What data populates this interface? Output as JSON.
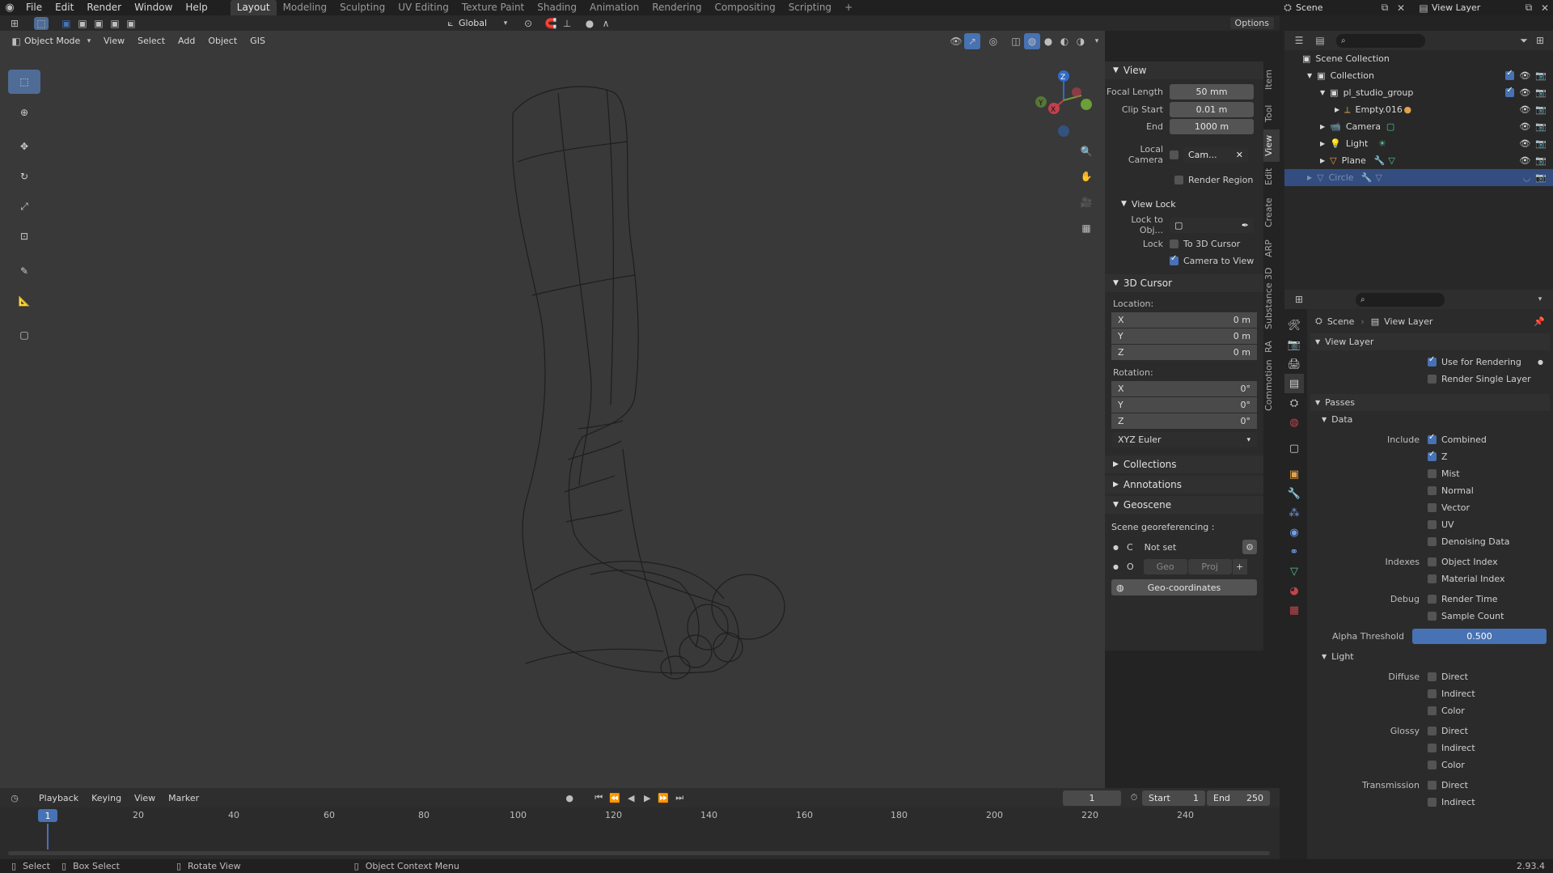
{
  "menu": [
    "File",
    "Edit",
    "Render",
    "Window",
    "Help"
  ],
  "workspaces": [
    "Layout",
    "Modeling",
    "Sculpting",
    "UV Editing",
    "Texture Paint",
    "Shading",
    "Animation",
    "Rendering",
    "Compositing",
    "Scripting"
  ],
  "active_workspace": "Layout",
  "scene_name": "Scene",
  "view_layer_name": "View Layer",
  "toolbar": {
    "orientation": "Global",
    "options": "Options"
  },
  "viewport_header": {
    "mode": "Object Mode",
    "menus": [
      "View",
      "Select",
      "Add",
      "Object",
      "GIS"
    ]
  },
  "gizmo_axes": {
    "x": "X",
    "y": "Y",
    "z": "Z"
  },
  "npanel": {
    "view_title": "View",
    "focal_length_label": "Focal Length",
    "focal_length": "50 mm",
    "clip_start_label": "Clip Start",
    "clip_start": "0.01 m",
    "end_label": "End",
    "clip_end": "1000 m",
    "local_camera_label": "Local Camera",
    "local_camera_value": "Cam...",
    "render_region_label": "Render Region",
    "view_lock_title": "View Lock",
    "lock_to_obj_label": "Lock to Obj...",
    "lock_label": "Lock",
    "to_3d_cursor_label": "To 3D Cursor",
    "camera_to_view_label": "Camera to View",
    "cursor_title": "3D Cursor",
    "location_label": "Location:",
    "loc": [
      {
        "axis": "X",
        "value": "0 m"
      },
      {
        "axis": "Y",
        "value": "0 m"
      },
      {
        "axis": "Z",
        "value": "0 m"
      }
    ],
    "rotation_label": "Rotation:",
    "rot": [
      {
        "axis": "X",
        "value": "0°"
      },
      {
        "axis": "Y",
        "value": "0°"
      },
      {
        "axis": "Z",
        "value": "0°"
      }
    ],
    "rotation_mode": "XYZ Euler",
    "collections_title": "Collections",
    "annotations_title": "Annotations",
    "geoscene_title": "Geoscene",
    "georef_label": "Scene georeferencing :",
    "c_label": "C",
    "not_set": "Not set",
    "o_label": "O",
    "geo_btn": "Geo",
    "proj_btn": "Proj",
    "geo_coords_btn": "Geo-coordinates"
  },
  "vertical_tabs": [
    "Item",
    "Tool",
    "View",
    "Edit",
    "Create",
    "ARP",
    "Substance 3D",
    "RA",
    "Commotion"
  ],
  "outliner": {
    "scene_collection": "Scene Collection",
    "items": [
      {
        "name": "Collection",
        "indent": 1
      },
      {
        "name": "pl_studio_group",
        "indent": 2
      },
      {
        "name": "Empty.016",
        "indent": 3
      },
      {
        "name": "Camera",
        "indent": 2
      },
      {
        "name": "Light",
        "indent": 2
      },
      {
        "name": "Plane",
        "indent": 2
      },
      {
        "name": "Circle",
        "indent": 1
      }
    ]
  },
  "properties": {
    "crumb_scene": "Scene",
    "crumb_view_layer": "View Layer",
    "view_layer_title": "View Layer",
    "use_for_rendering": "Use for Rendering",
    "render_single_layer": "Render Single Layer",
    "passes_title": "Passes",
    "data_title": "Data",
    "include_label": "Include",
    "include": [
      "Combined",
      "Z",
      "Mist",
      "Normal",
      "Vector",
      "UV",
      "Denoising Data"
    ],
    "indexes_label": "Indexes",
    "indexes": [
      "Object Index",
      "Material Index"
    ],
    "debug_label": "Debug",
    "debug": [
      "Render Time",
      "Sample Count"
    ],
    "alpha_label": "Alpha Threshold",
    "alpha_value": "0.500",
    "light_title": "Light",
    "diffuse_label": "Diffuse",
    "diffuse": [
      "Direct",
      "Indirect",
      "Color"
    ],
    "glossy_label": "Glossy",
    "glossy": [
      "Direct",
      "Indirect",
      "Color"
    ],
    "transmission_label": "Transmission",
    "transmission": [
      "Direct",
      "Indirect"
    ]
  },
  "timeline": {
    "menus": [
      "Playback",
      "Keying",
      "View",
      "Marker"
    ],
    "current_frame": "1",
    "start_label": "Start",
    "start": "1",
    "end_label": "End",
    "end": "250",
    "ticks": [
      "20",
      "40",
      "60",
      "80",
      "100",
      "120",
      "140",
      "160",
      "180",
      "200",
      "220",
      "240"
    ],
    "playhead": "1"
  },
  "status": {
    "select": "Select",
    "box_select": "Box Select",
    "rotate_view": "Rotate View",
    "context_menu": "Object Context Menu",
    "version": "2.93.4"
  },
  "colors": {
    "accent": "#4772b3",
    "active_tool": "#4f6c96",
    "selected_row": "#334d80"
  }
}
